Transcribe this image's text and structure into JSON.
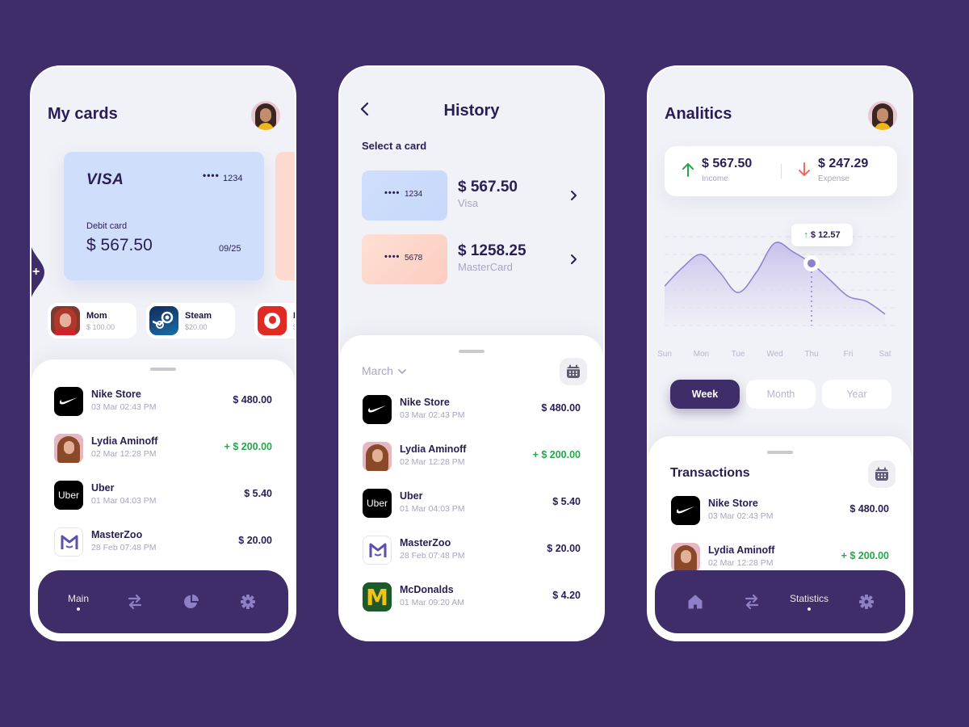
{
  "colors": {
    "background": "#3e2d68",
    "accent": "#3e2d68",
    "text_primary": "#2a1d55",
    "text_muted": "#a7a5c0",
    "positive": "#23a84a",
    "negative": "#f06a5e",
    "visa_card": "#cfdefb",
    "mastercard_card": "#fed9cf",
    "chart_line": "#8d80d2"
  },
  "my_cards": {
    "title": "My cards",
    "add_label": "+",
    "card": {
      "brand": "VISA",
      "dots": "••••",
      "last4": "1234",
      "type": "Debit card",
      "balance": "$ 567.50",
      "expiry": "09/25"
    },
    "contacts": [
      {
        "name": "Mom",
        "amount": "$ 100.00",
        "icon": "mom-avatar"
      },
      {
        "name": "Steam",
        "amount": "$20.00",
        "icon": "steam-icon"
      },
      {
        "name": "P",
        "amount": "$",
        "icon": "vodafone-icon"
      }
    ],
    "transactions": [
      {
        "name": "Nike Store",
        "date": "03 Mar 02:43 PM",
        "amount": "$ 480.00",
        "positive": false,
        "icon": "nike-icon"
      },
      {
        "name": "Lydia Aminoff",
        "date": "02 Mar 12:28 PM",
        "amount": "+ $ 200.00",
        "positive": true,
        "icon": "lydia-avatar"
      },
      {
        "name": "Uber",
        "date": "01 Mar 04:03 PM",
        "amount": "$ 5.40",
        "positive": false,
        "icon": "uber-icon"
      },
      {
        "name": "MasterZoo",
        "date": "28 Feb 07:48 PM",
        "amount": "$ 20.00",
        "positive": false,
        "icon": "masterzoo-icon"
      }
    ],
    "nav": {
      "active_label": "Main",
      "items": [
        "main",
        "transfer-icon",
        "pie-chart-icon",
        "gear-icon"
      ]
    }
  },
  "history": {
    "title": "History",
    "back_icon": "chevron-left-icon",
    "select_label": "Select a card",
    "cards": [
      {
        "dots": "••••",
        "last4": "1234",
        "amount": "$ 567.50",
        "brand": "Visa"
      },
      {
        "dots": "••••",
        "last4": "5678",
        "amount": "$ 1258.25",
        "brand": "MasterCard"
      }
    ],
    "month": "March",
    "transactions": [
      {
        "name": "Nike Store",
        "date": "03 Mar 02:43 PM",
        "amount": "$ 480.00",
        "positive": false,
        "icon": "nike-icon"
      },
      {
        "name": "Lydia Aminoff",
        "date": "02 Mar 12:28 PM",
        "amount": "+ $ 200.00",
        "positive": true,
        "icon": "lydia-avatar"
      },
      {
        "name": "Uber",
        "date": "01 Mar 04:03 PM",
        "amount": "$ 5.40",
        "positive": false,
        "icon": "uber-icon"
      },
      {
        "name": "MasterZoo",
        "date": "28 Feb 07:48 PM",
        "amount": "$ 20.00",
        "positive": false,
        "icon": "masterzoo-icon"
      },
      {
        "name": "McDonalds",
        "date": "01 Mar 09:20 AM",
        "amount": "$ 4.20",
        "positive": false,
        "icon": "mcdonalds-icon"
      }
    ]
  },
  "analytics": {
    "title": "Analitics",
    "income": {
      "amount": "$ 567.50",
      "label": "Income"
    },
    "expense": {
      "amount": "$ 247.29",
      "label": "Expense"
    },
    "tooltip": {
      "value": "$ 12.57",
      "day": "Thu"
    },
    "periods": [
      {
        "label": "Week",
        "active": true
      },
      {
        "label": "Month",
        "active": false
      },
      {
        "label": "Year",
        "active": false
      }
    ],
    "transactions_title": "Transactions",
    "transactions": [
      {
        "name": "Nike Store",
        "date": "03 Mar 02:43 PM",
        "amount": "$ 480.00",
        "positive": false,
        "icon": "nike-icon"
      },
      {
        "name": "Lydia Aminoff",
        "date": "02 Mar 12:28 PM",
        "amount": "+ $ 200.00",
        "positive": true,
        "icon": "lydia-avatar"
      }
    ],
    "nav": {
      "active_label": "Statistics",
      "items": [
        "home-icon",
        "transfer-icon",
        "statistics",
        "gear-icon"
      ]
    }
  },
  "chart_data": {
    "type": "area",
    "title": "",
    "categories": [
      "Sun",
      "Mon",
      "Tue",
      "Wed",
      "Thu",
      "Fri",
      "Sat"
    ],
    "x": [
      0,
      0.5,
      1,
      1.5,
      2,
      2.5,
      3,
      3.5,
      4,
      4.5,
      5,
      5.5,
      6
    ],
    "values": [
      3.1,
      4.6,
      5.6,
      4.2,
      2.6,
      4.2,
      6.5,
      5.8,
      4.9,
      3.6,
      2.3,
      1.9,
      0.9
    ],
    "highlight": {
      "category": "Thu",
      "label": "$ 12.57"
    },
    "xlabel": "",
    "ylabel": "",
    "ylim": [
      0,
      7
    ],
    "grid": true,
    "legend": "none"
  }
}
